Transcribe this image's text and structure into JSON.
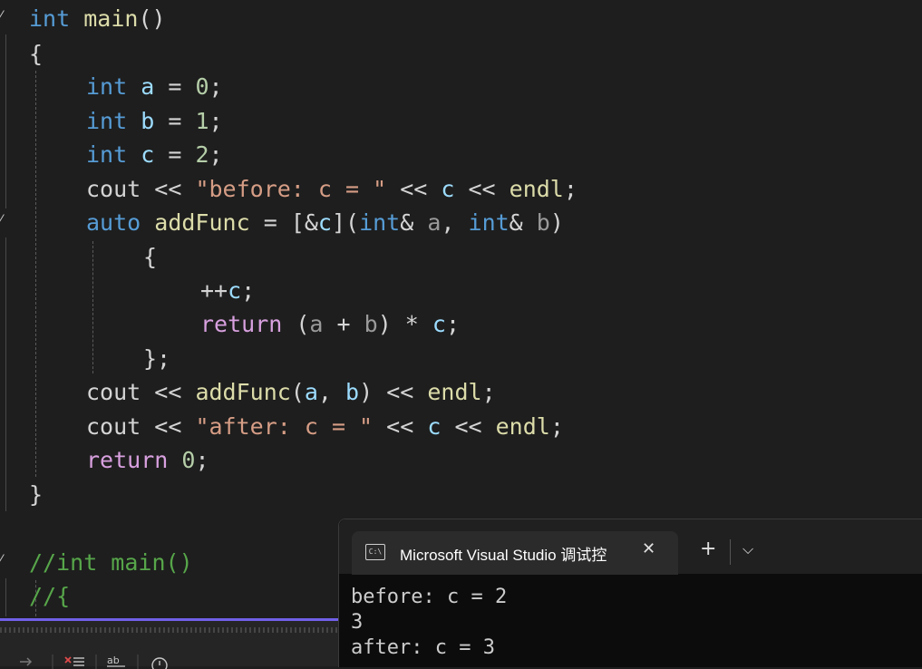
{
  "code": {
    "l1": {
      "t1": "int",
      "t2": "main",
      "t3": "()"
    },
    "l2": {
      "t1": "{"
    },
    "l3": {
      "t1": "int",
      "t2": "a",
      "t3": " = ",
      "t4": "0",
      "t5": ";"
    },
    "l4": {
      "t1": "int",
      "t2": "b",
      "t3": " = ",
      "t4": "1",
      "t5": ";"
    },
    "l5": {
      "t1": "int",
      "t2": "c",
      "t3": " = ",
      "t4": "2",
      "t5": ";"
    },
    "l6": {
      "t1": "cout",
      "t2": " << ",
      "t3": "\"before: c = \"",
      "t4": " << ",
      "t5": "c",
      "t6": " << ",
      "t7": "endl",
      "t8": ";"
    },
    "l7": {
      "t1": "auto",
      "t2": "addFunc",
      "t3": " = [&",
      "t4": "c",
      "t5": "](",
      "t6": "int",
      "t7": "& ",
      "t8": "a",
      "t9": ", ",
      "t10": "int",
      "t11": "& ",
      "t12": "b",
      "t13": ")"
    },
    "l8": {
      "t1": "{"
    },
    "l9": {
      "t1": "++",
      "t2": "c",
      "t3": ";"
    },
    "l10": {
      "t1": "return",
      "t2": " (",
      "t3": "a",
      "t4": " + ",
      "t5": "b",
      "t6": ") * ",
      "t7": "c",
      "t8": ";"
    },
    "l11": {
      "t1": "};"
    },
    "l12": {
      "t1": "cout",
      "t2": " << ",
      "t3": "addFunc",
      "t4": "(",
      "t5": "a",
      "t6": ", ",
      "t7": "b",
      "t8": ") << ",
      "t9": "endl",
      "t10": ";"
    },
    "l13": {
      "t1": "cout",
      "t2": " << ",
      "t3": "\"after: c = \"",
      "t4": " << ",
      "t5": "c",
      "t6": " << ",
      "t7": "endl",
      "t8": ";"
    },
    "l14": {
      "t1": "return",
      "t2": " ",
      "t3": "0",
      "t4": ";"
    },
    "l15": {
      "t1": "}"
    },
    "l16": {
      "t1": "//int main()"
    },
    "l17": {
      "t1": "//{"
    }
  },
  "terminal": {
    "tab_title": "Microsoft Visual Studio 调试控",
    "tab_icon_text": "C:\\",
    "close_glyph": "✕",
    "add_glyph": "+",
    "dropdown_glyph": "⌵",
    "output": [
      "before: c = 2",
      "3",
      "after: c = 3"
    ]
  },
  "icons": {
    "fold_collapse": "⁄",
    "toolbar": [
      "arrow-right-icon",
      "clear-list-icon",
      "text-format-icon",
      "clock-icon"
    ]
  },
  "colors": {
    "keyword": "#569cd6",
    "control": "#d8a0df",
    "variable": "#9cdcfe",
    "number": "#b5cea8",
    "string": "#d69d85",
    "function": "#dcdcaa",
    "comment": "#57a64a",
    "accent": "#7160e8"
  }
}
